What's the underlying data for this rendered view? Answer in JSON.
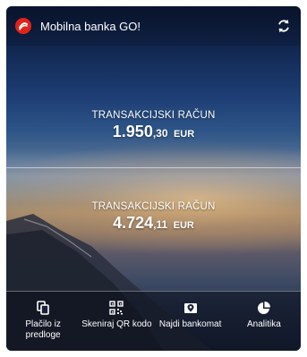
{
  "header": {
    "title": "Mobilna banka GO!",
    "logo_icon": "bank-logo-icon",
    "refresh_icon": "refresh-icon"
  },
  "accounts": [
    {
      "label": "TRANSAKCIJSKI RAČUN",
      "amount_int": "1.950",
      "amount_dec": ",30",
      "currency": "EUR"
    },
    {
      "label": "TRANSAKCIJSKI RAČUN",
      "amount_int": "4.724",
      "amount_dec": ",11",
      "currency": "EUR"
    }
  ],
  "actions": [
    {
      "label_line1": "Plačilo iz",
      "label_line2": "predloge",
      "icon": "copy-template-icon"
    },
    {
      "label_line1": "Skeniraj QR kodo",
      "label_line2": "",
      "icon": "qr-code-icon"
    },
    {
      "label_line1": "Najdi bankomat",
      "label_line2": "",
      "icon": "map-pin-icon"
    },
    {
      "label_line1": "Analitika",
      "label_line2": "",
      "icon": "pie-chart-icon"
    }
  ],
  "colors": {
    "brand": "#e2231a",
    "text": "#ffffff"
  }
}
